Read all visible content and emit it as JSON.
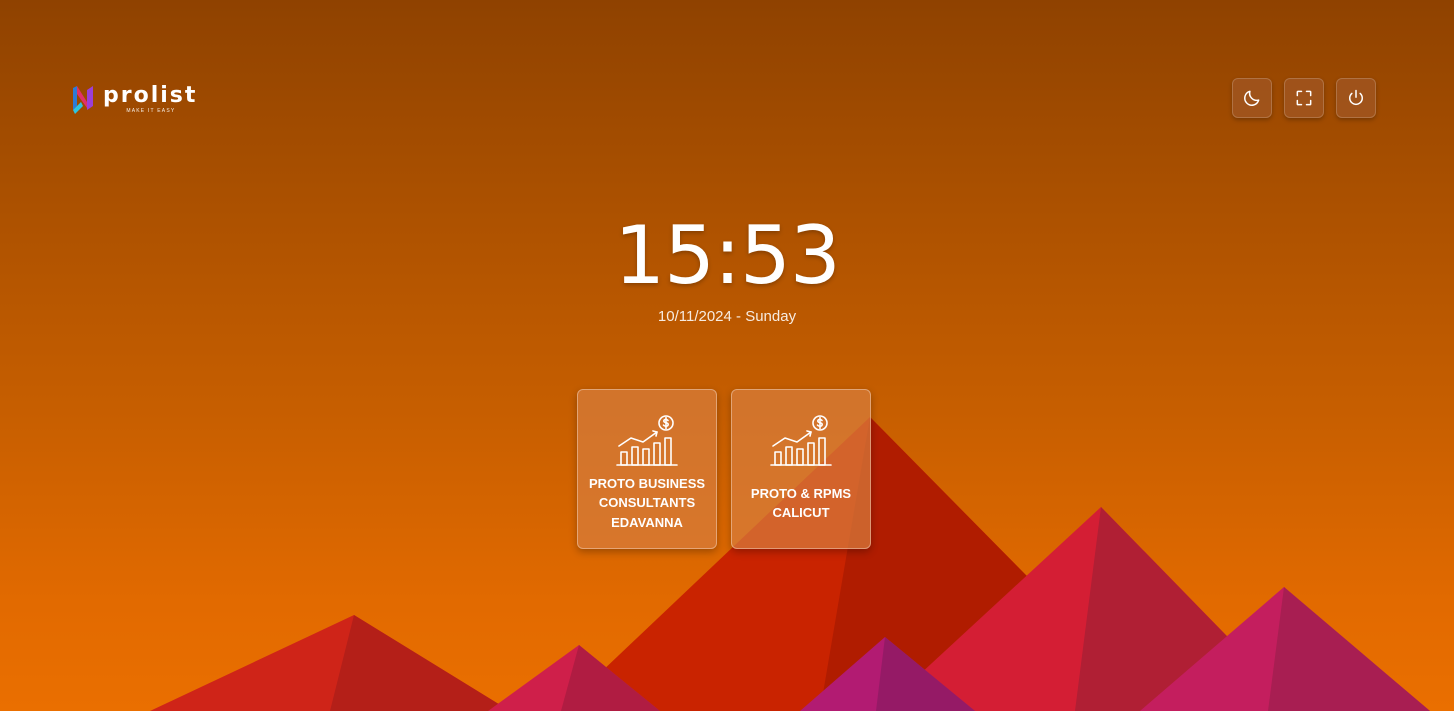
{
  "brand": {
    "name": "prolist",
    "tagline": "MAKE IT EASY"
  },
  "toolbar": {
    "buttons": [
      {
        "icon": "moon-icon",
        "action": "toggle-dark-mode"
      },
      {
        "icon": "fullscreen-icon",
        "action": "toggle-fullscreen"
      },
      {
        "icon": "power-icon",
        "action": "power"
      }
    ]
  },
  "clock": {
    "time": "15:53",
    "date": "10/11/2024 - Sunday"
  },
  "companies": [
    {
      "name": "PROTO BUSINESS\nCONSULTANTS\nEDAVANNA",
      "icon": "growth-chart-dollar-icon"
    },
    {
      "name": "PROTO & RPMS\nCALICUT",
      "icon": "growth-chart-dollar-icon"
    }
  ],
  "colors": {
    "background_top": "#8f4200",
    "background_bottom": "#ea6f00",
    "card_fill": "#d77d3c",
    "mountain_red": "#c42000",
    "mountain_crimson": "#d42030",
    "mountain_magenta": "#c21f5e"
  }
}
